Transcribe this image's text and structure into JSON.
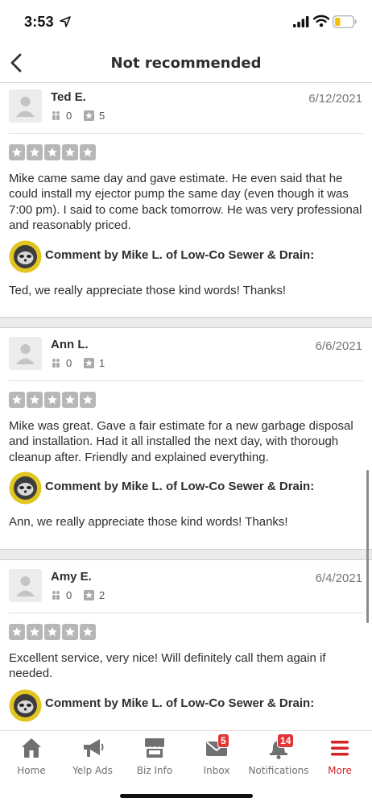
{
  "status": {
    "time": "3:53"
  },
  "nav": {
    "title": "Not recommended"
  },
  "reviews": [
    {
      "name": "Ted E.",
      "friends": "0",
      "reviews": "5",
      "date": "6/12/2021",
      "text": "Mike came same day and gave estimate. He even said that he could install my ejector pump the same day (even though it was 7:00 pm). I said to come back tomorrow. He was very professional and reasonably priced.",
      "comment_by": "Comment by Mike L. of Low-Co Sewer & Drain:",
      "reply": "Ted, we really appreciate those kind words! Thanks!"
    },
    {
      "name": "Ann L.",
      "friends": "0",
      "reviews": "1",
      "date": "6/6/2021",
      "text": "Mike was great. Gave a fair estimate for a new garbage disposal and installation.  Had it all installed the next day, with thorough cleanup after.  Friendly and explained everything.",
      "comment_by": "Comment by Mike L. of Low-Co Sewer & Drain:",
      "reply": "Ann, we really appreciate those kind words! Thanks!"
    },
    {
      "name": "Amy E.",
      "friends": "0",
      "reviews": "2",
      "date": "6/4/2021",
      "text": "Excellent service, very nice!  Will definitely call them again if needed.",
      "comment_by": "Comment by Mike L. of Low-Co Sewer & Drain:"
    }
  ],
  "tabs": [
    {
      "label": "Home",
      "icon": "home-icon"
    },
    {
      "label": "Yelp Ads",
      "icon": "megaphone-icon"
    },
    {
      "label": "Biz Info",
      "icon": "storefront-icon"
    },
    {
      "label": "Inbox",
      "icon": "envelope-icon",
      "badge": "5"
    },
    {
      "label": "Notifications",
      "icon": "bell-icon",
      "badge": "14"
    },
    {
      "label": "More",
      "icon": "menu-icon"
    }
  ],
  "colors": {
    "accent": "#d32323",
    "star_gray": "#b7b7b7",
    "badge": "#e0353b"
  }
}
